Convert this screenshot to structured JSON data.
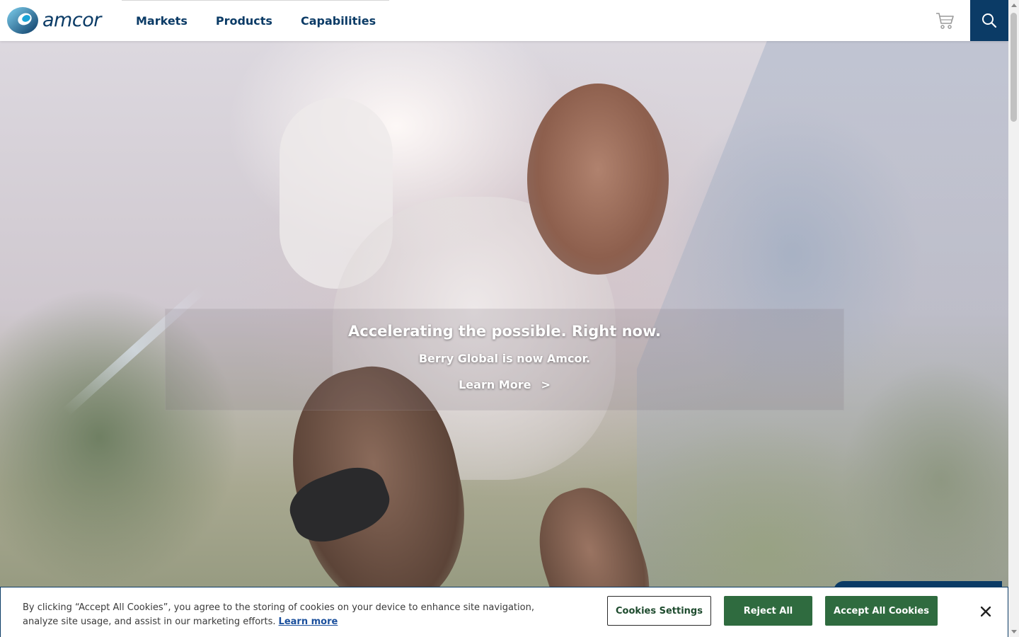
{
  "header": {
    "logo_text": "amcor",
    "nav": [
      {
        "label": "Markets"
      },
      {
        "label": "Products"
      },
      {
        "label": "Capabilities"
      }
    ],
    "icons": {
      "cart": "cart-icon",
      "search": "search-icon"
    },
    "colors": {
      "brand": "#0b3b66"
    }
  },
  "hero": {
    "title": "Accelerating the possible. Right now.",
    "subtitle": "Berry Global is now Amcor.",
    "cta_label": "Learn More",
    "cta_chevron": ">"
  },
  "cookie_banner": {
    "text": "By clicking “Accept All Cookies”, you agree to the storing of cookies on your device to enhance site navigation, analyze site usage, and assist in our marketing efforts.",
    "learn_more": "Learn more",
    "settings_label": "Cookies Settings",
    "reject_label": "Reject All",
    "accept_label": "Accept All Cookies",
    "close_icon": "close-icon",
    "colors": {
      "button": "#2f6b3f",
      "border": "#0b3b66"
    }
  }
}
